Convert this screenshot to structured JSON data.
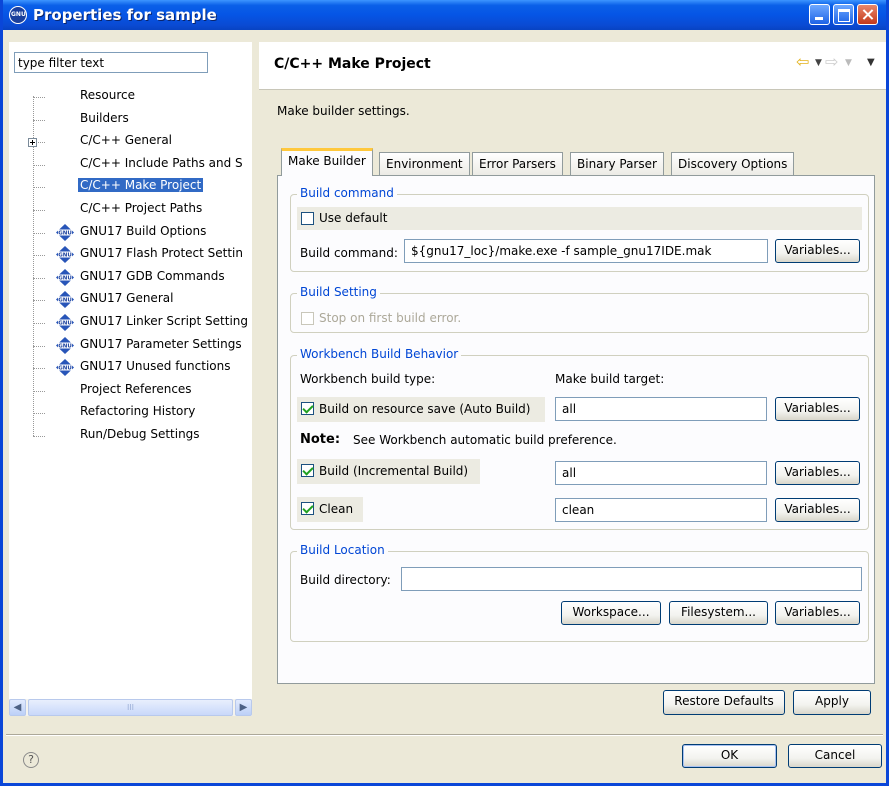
{
  "window": {
    "title": "Properties for sample",
    "title_bar_color": "#0a5fe8"
  },
  "filter": {
    "placeholder": "type filter text",
    "value": "type filter text"
  },
  "tree": {
    "selected_color": "#316ac5",
    "items": [
      {
        "label": "Resource",
        "icon": "none"
      },
      {
        "label": "Builders",
        "icon": "none"
      },
      {
        "label": "C/C++ General",
        "icon": "none",
        "expandable": true
      },
      {
        "label": "C/C++ Include Paths and S",
        "icon": "none"
      },
      {
        "label": "C/C++ Make Project",
        "icon": "none",
        "selected": true
      },
      {
        "label": "C/C++ Project Paths",
        "icon": "none"
      },
      {
        "label": "GNU17 Build Options",
        "icon": "gnu-icon"
      },
      {
        "label": "GNU17 Flash Protect Settin",
        "icon": "gnu-icon"
      },
      {
        "label": "GNU17 GDB Commands",
        "icon": "gnu-icon"
      },
      {
        "label": "GNU17 General",
        "icon": "gnu-icon"
      },
      {
        "label": "GNU17 Linker Script Setting",
        "icon": "gnu-icon"
      },
      {
        "label": "GNU17 Parameter Settings",
        "icon": "gnu-icon"
      },
      {
        "label": "GNU17 Unused functions",
        "icon": "gnu-icon"
      },
      {
        "label": "Project References",
        "icon": "none"
      },
      {
        "label": "Refactoring History",
        "icon": "none"
      },
      {
        "label": "Run/Debug Settings",
        "icon": "none"
      }
    ],
    "scroll_thumb_glyph": "III"
  },
  "page": {
    "title": "C/C++ Make Project",
    "description": "Make builder settings."
  },
  "tabs": [
    {
      "label": "Make Builder",
      "active": true
    },
    {
      "label": "Environment"
    },
    {
      "label": "Error Parsers"
    },
    {
      "label": "Binary Parser"
    },
    {
      "label": "Discovery Options"
    }
  ],
  "build_command": {
    "group_title": "Build command",
    "use_default_label": "Use default",
    "use_default_checked": false,
    "command_label": "Build command:",
    "command_value": "${gnu17_loc}/make.exe -f sample_gnu17IDE.mak",
    "variables_label": "Variables..."
  },
  "build_setting": {
    "group_title": "Build Setting",
    "stop_on_error_label": "Stop on first build error.",
    "stop_on_error_checked": false,
    "stop_on_error_enabled": false
  },
  "workbench": {
    "group_title": "Workbench Build Behavior",
    "build_type_label": "Workbench build type:",
    "target_label": "Make build target:",
    "auto_build_label": "Build on resource save (Auto Build)",
    "auto_build_checked": true,
    "auto_build_target": "all",
    "note_bold": "Note:",
    "note_text": "See Workbench automatic build preference.",
    "incremental_label": "Build (Incremental Build)",
    "incremental_checked": true,
    "incremental_target": "all",
    "clean_label": "Clean",
    "clean_checked": true,
    "clean_target": "clean",
    "variables_label": "Variables..."
  },
  "build_location": {
    "group_title": "Build Location",
    "directory_label": "Build directory:",
    "directory_value": "",
    "workspace_label": "Workspace...",
    "filesystem_label": "Filesystem...",
    "variables_label": "Variables..."
  },
  "actions": {
    "restore_defaults": "Restore Defaults",
    "apply": "Apply",
    "ok": "OK",
    "cancel": "Cancel",
    "help_glyph": "?"
  },
  "nav": {
    "back_glyph": "⇦",
    "forward_glyph": "⇨",
    "dropdown_glyph": "▼",
    "menu_glyph": "▼"
  }
}
